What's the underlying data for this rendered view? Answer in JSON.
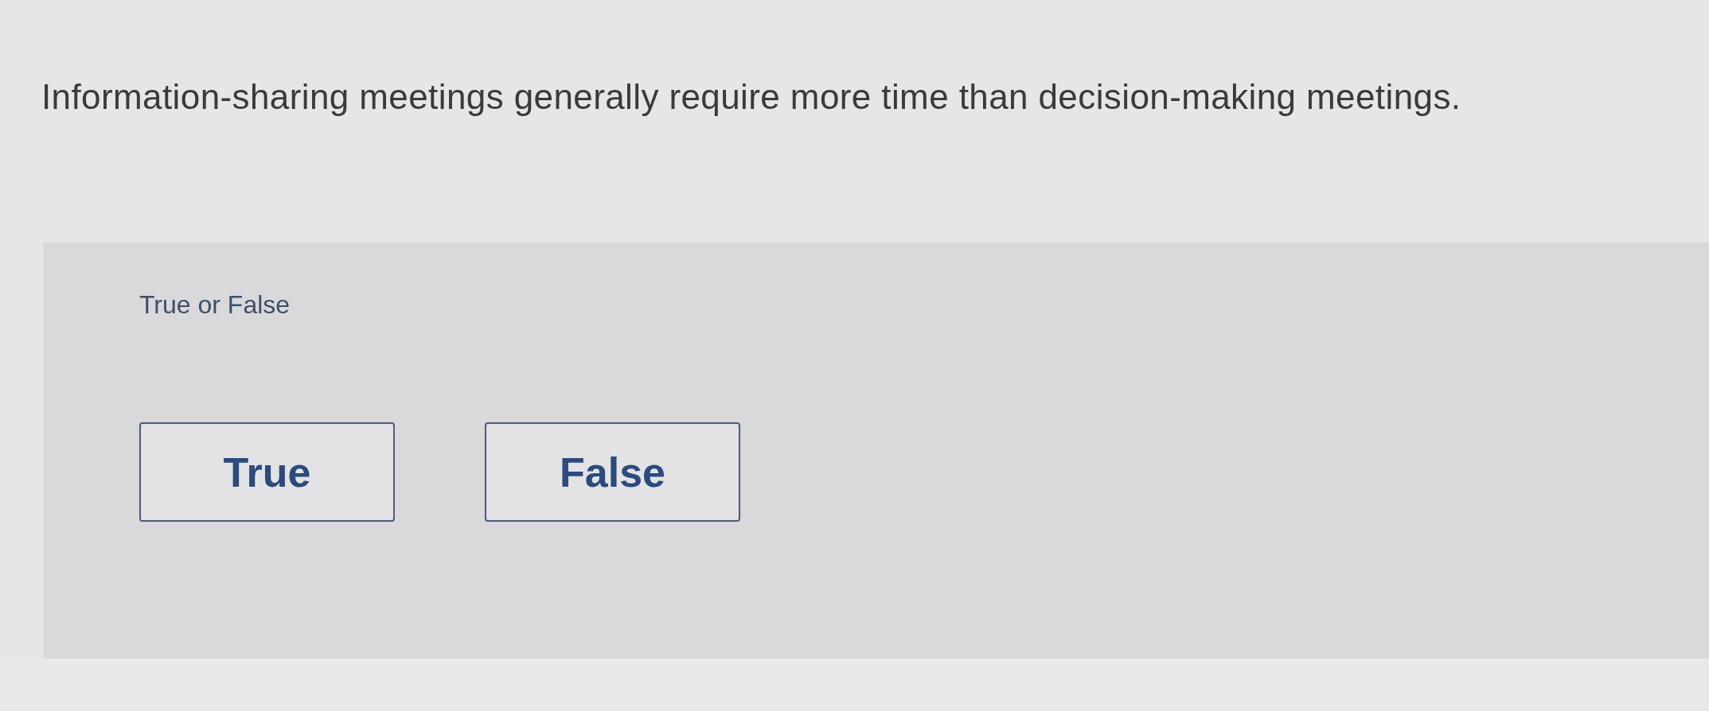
{
  "question": "Information-sharing meetings generally require more time than decision-making meetings.",
  "answer_panel": {
    "label": "True or False",
    "options": [
      {
        "label": "True",
        "selected": false
      },
      {
        "label": "False",
        "selected": false
      }
    ]
  }
}
